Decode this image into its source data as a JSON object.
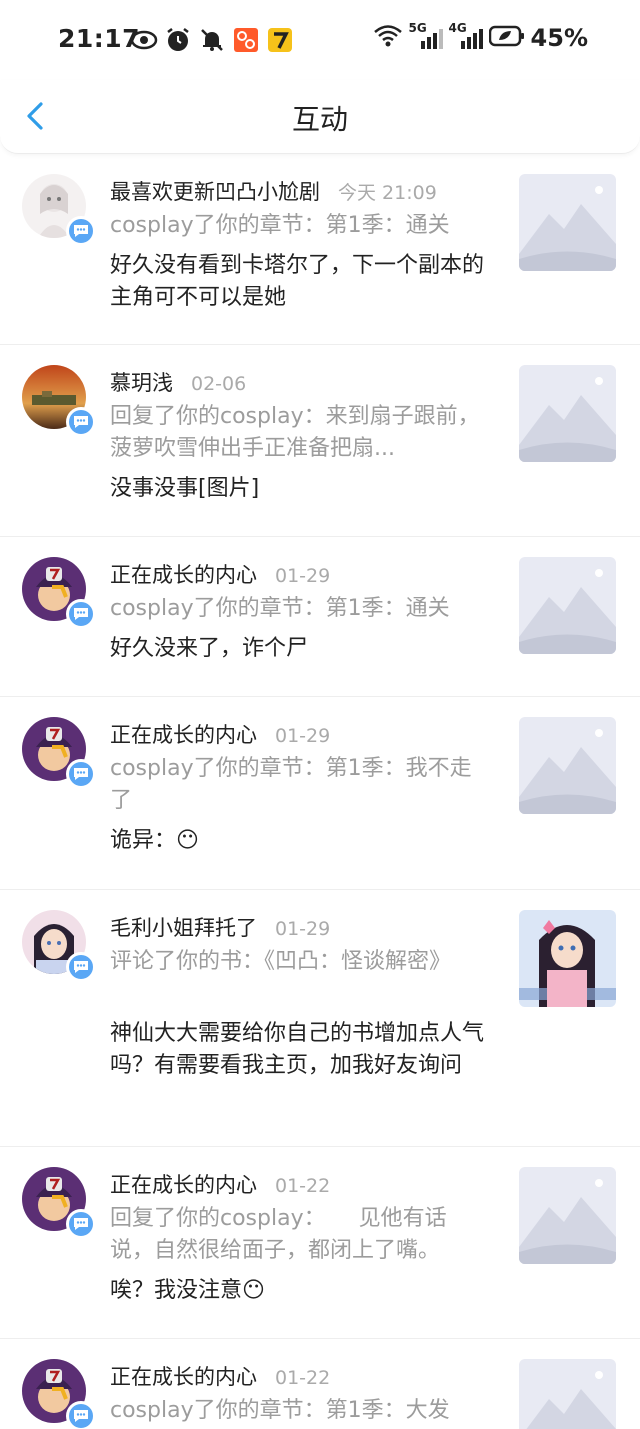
{
  "status_bar": {
    "time": "21:17",
    "network_5g": "5G",
    "network_4g": "4G",
    "battery": "45%"
  },
  "header": {
    "title": "互动"
  },
  "items": [
    {
      "name": "最喜欢更新凹凸小尬剧",
      "time": "今天 21:09",
      "ref": "cosplay了你的章节：第1季：通关",
      "reply": "好久没有看到卡塔尔了，下一个副本的主角可不可以是她"
    },
    {
      "name": "慕玥浅",
      "time": "02-06",
      "ref": "回复了你的cosplay：来到扇子跟前，菠萝吹雪伸出手正准备把扇...",
      "reply": "没事没事[图片]"
    },
    {
      "name": "正在成长的内心",
      "time": "01-29",
      "ref": "cosplay了你的章节：第1季：通关",
      "reply": "好久没来了，诈个尸"
    },
    {
      "name": "正在成长的内心",
      "time": "01-29",
      "ref": "cosplay了你的章节：第1季：我不走了",
      "reply": "诡异：😶"
    },
    {
      "name": "毛利小姐拜托了",
      "time": "01-29",
      "ref": "评论了你的书：《凹凸：怪谈解密》",
      "reply": "神仙大大需要给你自己的书增加点人气吗？有需要看我主页，加我好友询问"
    },
    {
      "name": "正在成长的内心",
      "time": "01-22",
      "ref": "回复了你的cosplay：　　见他有话说，自然很给面子，都闭上了嘴。",
      "reply": "唉？我没注意😶"
    },
    {
      "name": "正在成长的内心",
      "time": "01-22",
      "ref": "cosplay了你的章节：第1季：大发",
      "reply": ""
    }
  ]
}
